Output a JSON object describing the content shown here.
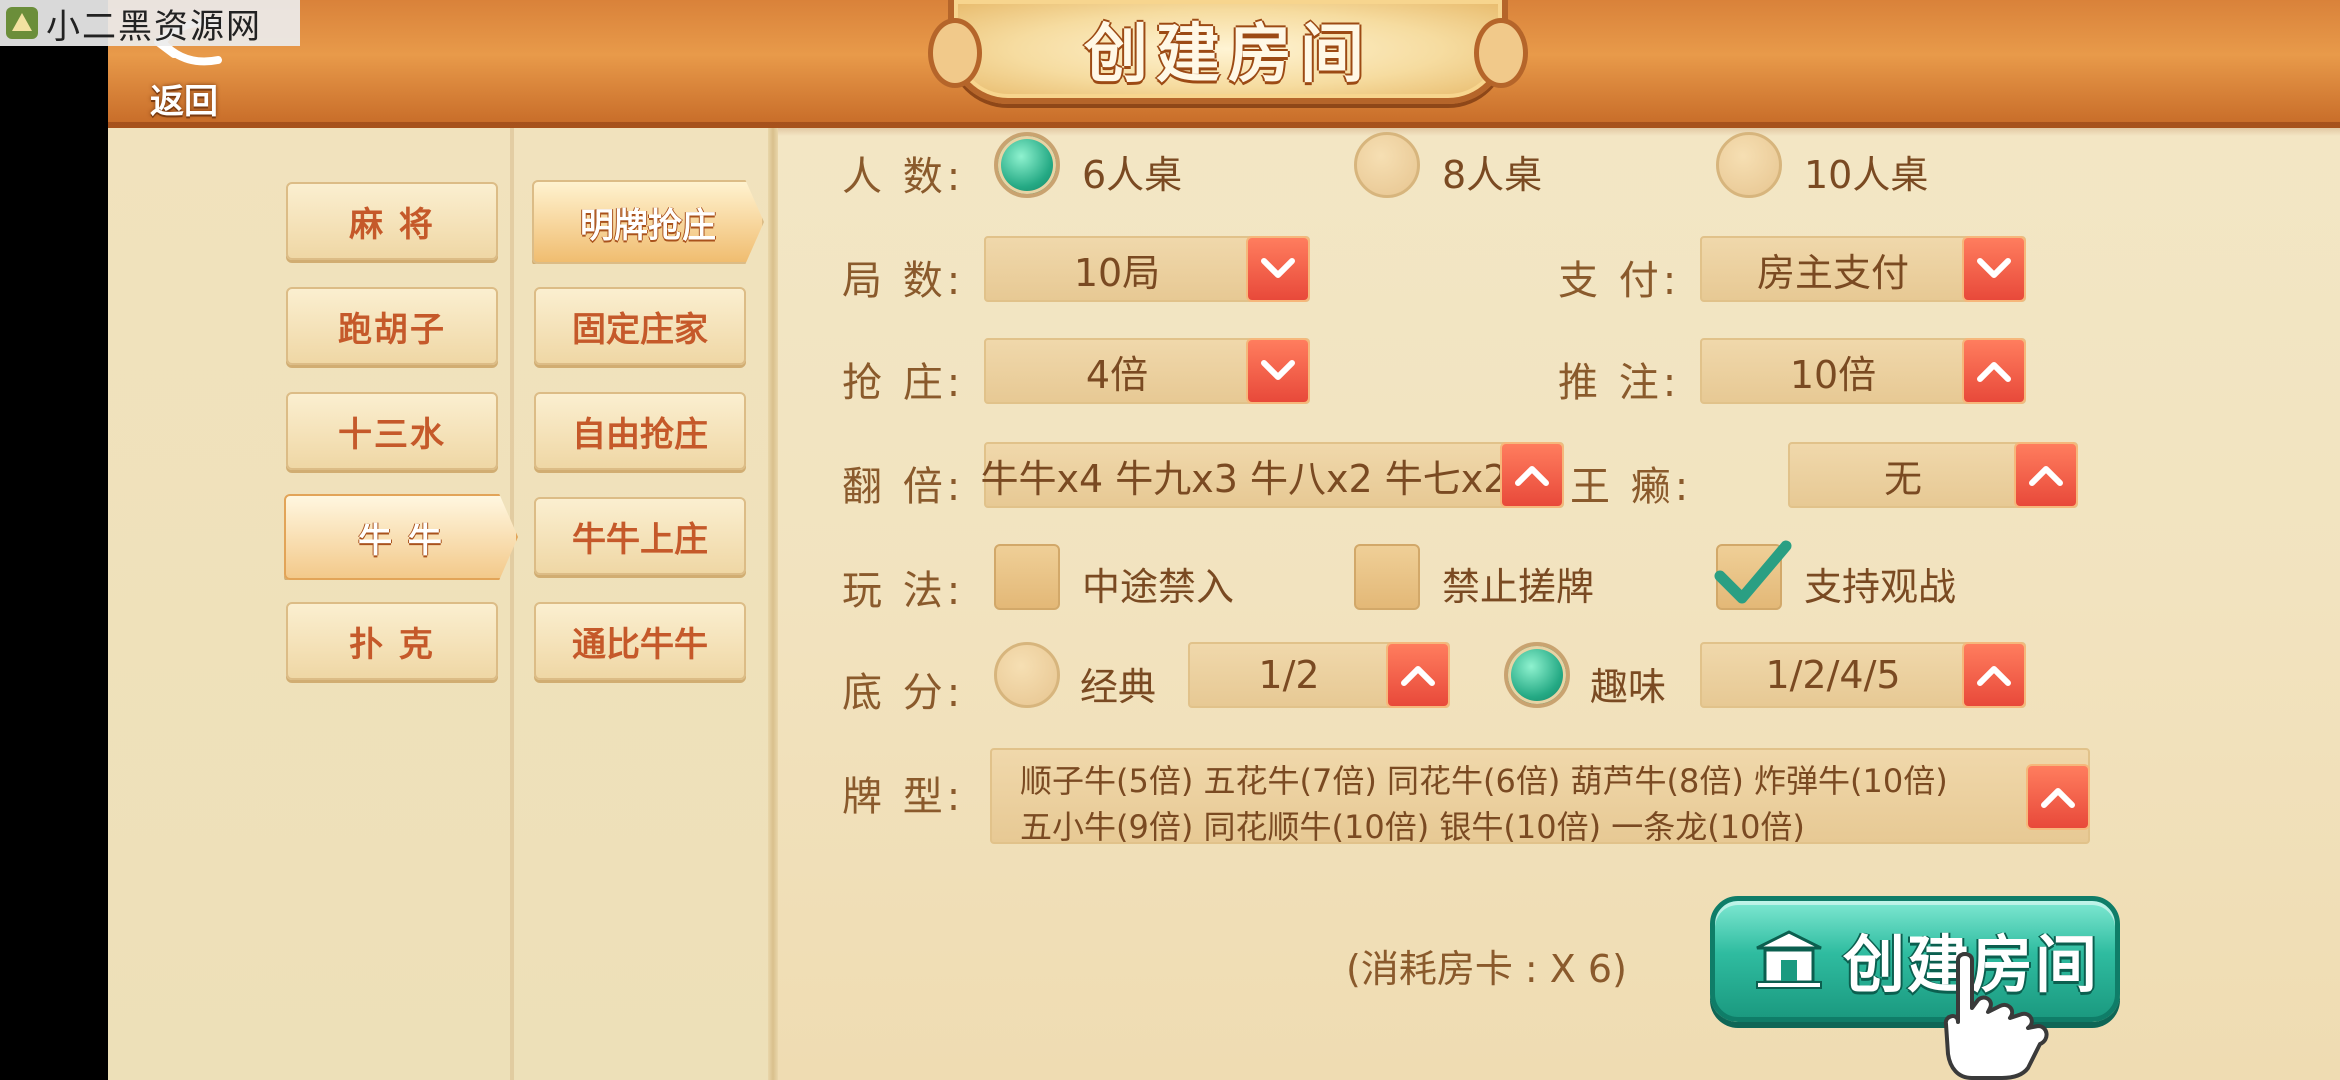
{
  "watermark": {
    "text": "小二黑资源网"
  },
  "header": {
    "back_label": "返回",
    "title": "创建房间"
  },
  "colors": {
    "accent_red": "#e8493a",
    "teal": "#24a984",
    "header_orange": "#d9823a"
  },
  "categories": [
    {
      "label": "麻 将",
      "active": false
    },
    {
      "label": "跑胡子",
      "active": false
    },
    {
      "label": "十三水",
      "active": false
    },
    {
      "label": "牛 牛",
      "active": true
    },
    {
      "label": "扑 克",
      "active": false
    }
  ],
  "modes": [
    {
      "label": "明牌抢庄",
      "active": true
    },
    {
      "label": "固定庄家",
      "active": false
    },
    {
      "label": "自由抢庄",
      "active": false
    },
    {
      "label": "牛牛上庄",
      "active": false
    },
    {
      "label": "通比牛牛",
      "active": false
    }
  ],
  "players": {
    "label": "人 数:",
    "options": [
      {
        "label": "6人桌",
        "selected": true
      },
      {
        "label": "8人桌",
        "selected": false
      },
      {
        "label": "10人桌",
        "selected": false
      }
    ]
  },
  "rounds": {
    "label": "局 数:",
    "value": "10局",
    "icon": "chevron-down-icon"
  },
  "payment": {
    "label": "支 付:",
    "value": "房主支付",
    "icon": "chevron-down-icon"
  },
  "grab": {
    "label": "抢 庄:",
    "value": "4倍",
    "icon": "chevron-down-icon"
  },
  "push": {
    "label": "推 注:",
    "value": "10倍",
    "icon": "chevron-up-icon"
  },
  "multiplier": {
    "label": "翻 倍:",
    "value": "牛牛x4 牛九x3 牛八x2 牛七x2",
    "icon": "chevron-up-icon"
  },
  "wildcard": {
    "label": "王 癞:",
    "value": "无",
    "icon": "chevron-up-icon"
  },
  "gameplay": {
    "label": "玩 法:",
    "options": [
      {
        "label": "中途禁入",
        "checked": false
      },
      {
        "label": "禁止搓牌",
        "checked": false
      },
      {
        "label": "支持观战",
        "checked": true
      }
    ]
  },
  "base_score": {
    "label": "底 分:",
    "classic": {
      "label": "经典",
      "selected": false,
      "value": "1/2"
    },
    "fun": {
      "label": "趣味",
      "selected": true,
      "value": "1/2/4/5"
    }
  },
  "card_types": {
    "label": "牌 型:",
    "line1": "顺子牛(5倍) 五花牛(7倍) 同花牛(6倍) 葫芦牛(8倍) 炸弹牛(10倍)",
    "line2": "五小牛(9倍) 同花顺牛(10倍) 银牛(10倍) 一条龙(10倍)"
  },
  "cost": {
    "text": "(消耗房卡 : X 6)"
  },
  "create": {
    "label": "创建房间"
  }
}
